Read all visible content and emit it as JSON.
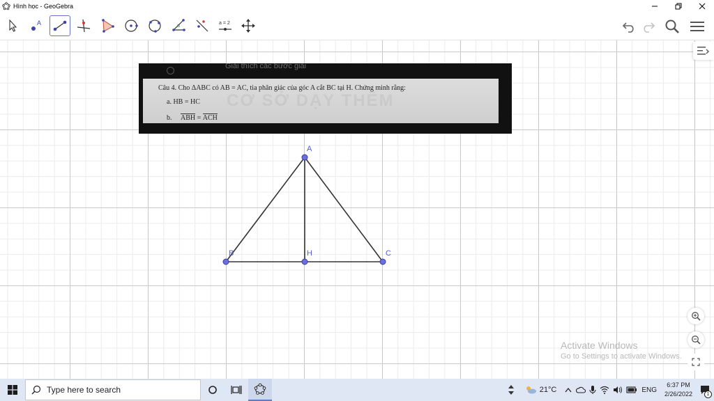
{
  "window": {
    "title": "Hình học - GeoGebra"
  },
  "toolbar": {
    "tools": [
      {
        "name": "move-tool",
        "icon": "arrow-pointer-icon"
      },
      {
        "name": "point-tool",
        "icon": "point-icon",
        "label": "A"
      },
      {
        "name": "segment-tool",
        "icon": "segment-icon",
        "active": true
      },
      {
        "name": "perpendicular-tool",
        "icon": "perpendicular-line-icon"
      },
      {
        "name": "polygon-tool",
        "icon": "polygon-icon"
      },
      {
        "name": "circle-tool",
        "icon": "circle-center-point-icon"
      },
      {
        "name": "circle-three-points-tool",
        "icon": "circle-three-points-icon"
      },
      {
        "name": "angle-tool",
        "icon": "angle-icon",
        "label": "α"
      },
      {
        "name": "reflect-tool",
        "icon": "reflect-icon"
      },
      {
        "name": "slider-tool",
        "icon": "slider-icon",
        "label": "a = 2"
      },
      {
        "name": "move-graphics-tool",
        "icon": "move-cross-icon"
      }
    ],
    "right": [
      "undo-icon",
      "redo-icon",
      "search-icon",
      "menu-icon"
    ]
  },
  "pasted_image": {
    "faint_header": "Giải thích các bước giải",
    "question": "Câu 4. Cho ΔABC có AB = AC, tia phân giác của góc A cắt BC tại H. Chứng minh rằng:",
    "part_a": "a.  HB = HC",
    "part_b_prefix": "b.",
    "part_b_lhs": "ABH",
    "part_b_eq": "=",
    "part_b_rhs": "ACH",
    "watermark": "CƠ SỞ DẠY THÊM"
  },
  "geometry": {
    "points": [
      {
        "label": "A"
      },
      {
        "label": "B"
      },
      {
        "label": "H"
      },
      {
        "label": "C"
      }
    ],
    "point_color": "#6b6fe0",
    "line_color": "#333333"
  },
  "watermark_os": {
    "line1": "Activate Windows",
    "line2": "Go to Settings to activate Windows."
  },
  "taskbar": {
    "search_placeholder": "Type here to search",
    "temperature": "21°C",
    "language": "ENG",
    "time": "6:37 PM",
    "date": "2/26/2022",
    "notification_count": "1"
  },
  "colors": {
    "accent": "#6d73c8",
    "taskbar": "#dfe7f5"
  }
}
